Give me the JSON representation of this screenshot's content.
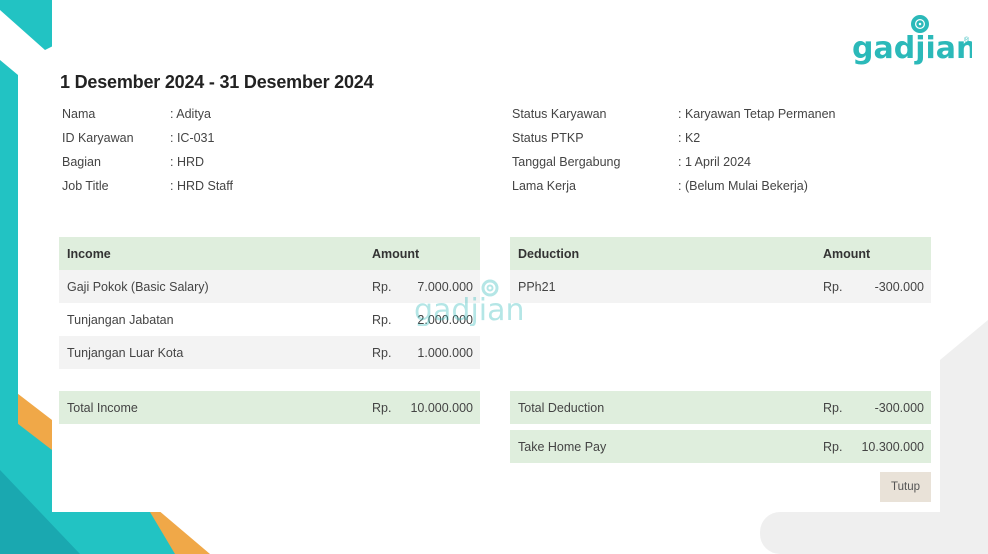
{
  "brand": {
    "name": "gadjian",
    "registered_mark": "®",
    "color": "#2bb9b9"
  },
  "period": "1 Desember 2024 - 31 Desember 2024",
  "employee_left": [
    {
      "label": "Nama",
      "value": ": Aditya"
    },
    {
      "label": "ID Karyawan",
      "value": ": IC-031"
    },
    {
      "label": "Bagian",
      "value": ": HRD"
    },
    {
      "label": "Job Title",
      "value": ": HRD Staff"
    }
  ],
  "employee_right": [
    {
      "label": "Status Karyawan",
      "value": ": Karyawan Tetap Permanen"
    },
    {
      "label": "Status PTKP",
      "value": ": K2"
    },
    {
      "label": "Tanggal Bergabung",
      "value": ": 1 April 2024"
    },
    {
      "label": "Lama Kerja",
      "value": ": (Belum Mulai Bekerja)"
    }
  ],
  "income": {
    "header": {
      "name": "Income",
      "amount": "Amount"
    },
    "rows": [
      {
        "name": "Gaji Pokok (Basic Salary)",
        "currency": "Rp.",
        "value": "7.000.000"
      },
      {
        "name": "Tunjangan Jabatan",
        "currency": "Rp.",
        "value": "2.000.000"
      },
      {
        "name": "Tunjangan Luar Kota",
        "currency": "Rp.",
        "value": "1.000.000"
      }
    ],
    "total": {
      "name": "Total Income",
      "currency": "Rp.",
      "value": "10.000.000"
    }
  },
  "deduction": {
    "header": {
      "name": "Deduction",
      "amount": "Amount"
    },
    "rows": [
      {
        "name": "PPh21",
        "currency": "Rp.",
        "value": "-300.000"
      }
    ],
    "total": {
      "name": "Total Deduction",
      "currency": "Rp.",
      "value": "-300.000"
    }
  },
  "take_home_pay": {
    "name": "Take Home Pay",
    "currency": "Rp.",
    "value": "10.300.000"
  },
  "close_button": "Tutup",
  "colors": {
    "teal": "#22c3c3",
    "orange": "#f0a848",
    "table_green": "#dfeedd",
    "row_gray": "#f3f3f3",
    "button_beige": "#e9e2d8"
  }
}
